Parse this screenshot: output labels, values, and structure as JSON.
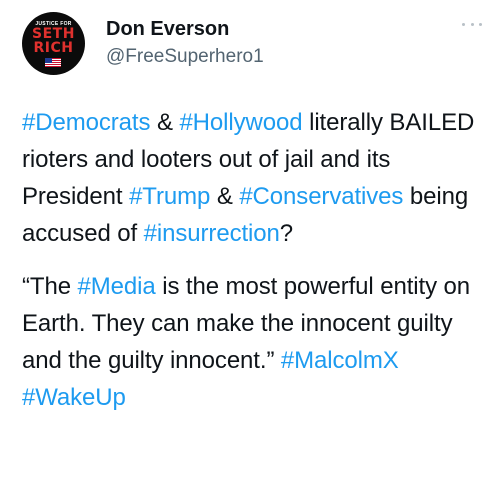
{
  "author": {
    "display_name": "Don Everson",
    "handle": "@FreeSuperhero1",
    "avatar": {
      "top_text": "JUSTICE FOR",
      "line1": "SETH",
      "line2": "RICH"
    }
  },
  "more_icon": "more-horizontal-icon",
  "colors": {
    "hashtag": "#1d9bf0",
    "text": "#0f1419",
    "secondary": "#536471"
  },
  "paragraph1": {
    "s1": "#Democrats",
    "s2": " & ",
    "s3": "#Hollywood",
    "s4": " literally BAILED rioters and looters out of jail and its President ",
    "s5": "#Trump",
    "s6": " & ",
    "s7": "#Conservatives",
    "s8": " being accused of ",
    "s9": "#insurrection",
    "s10": "?"
  },
  "paragraph2": {
    "s1": "“The ",
    "s2": "#Media",
    "s3": " is the most powerful entity on Earth. They can make the innocent guilty and the guilty innocent.” ",
    "s4": "#MalcolmX",
    "s5": " ",
    "s6": "#WakeUp"
  }
}
